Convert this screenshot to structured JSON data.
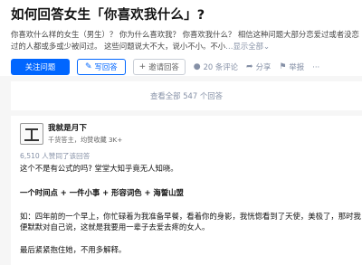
{
  "question": {
    "title": "如何回答女生「你喜欢我什么」?",
    "description": "你喜欢什么样的女生（男生）？ 你为什么喜欢我？ 你喜欢我什么？ 相信这种问题大部分恋爱过或者没恋过的人都或多或少被问过。 这些问题说大不大，说小不小。不小",
    "more_label": "…显示全部",
    "more_icon": "chevron-down-icon",
    "follow_label": "关注问题",
    "answer_label": "写回答",
    "invite_label": "邀请回答",
    "comments_label": "20 条评论",
    "share_label": "分享",
    "report_label": "举报",
    "more_actions_label": "···"
  },
  "view_all": {
    "label": "查看全部 547 个回答"
  },
  "answer": {
    "author_name": "我就是月下",
    "author_meta": "千货答主，均赞收藏 3K+",
    "agree_text": "6,510 人赞同了该回答",
    "paragraphs": [
      "这个不是有公式的吗? 堂堂大知乎竟无人知晓。",
      "一个时间点 + 一件小事 + 形容词色 + 海誓山盟",
      "如：四年前的一个早上，你忙碌着为我准备早餐，看着你的身影，我恍惚看到了天使，美极了，那时我便默默对自己说，这就是我要用一辈子去爱去疼的女人。",
      "最后紧紧抱住她，不用多解释。"
    ]
  },
  "colors": {
    "brand_blue": "#0066ff",
    "meta_gray": "#8590a6",
    "page_bg": "#f6f6f6"
  }
}
